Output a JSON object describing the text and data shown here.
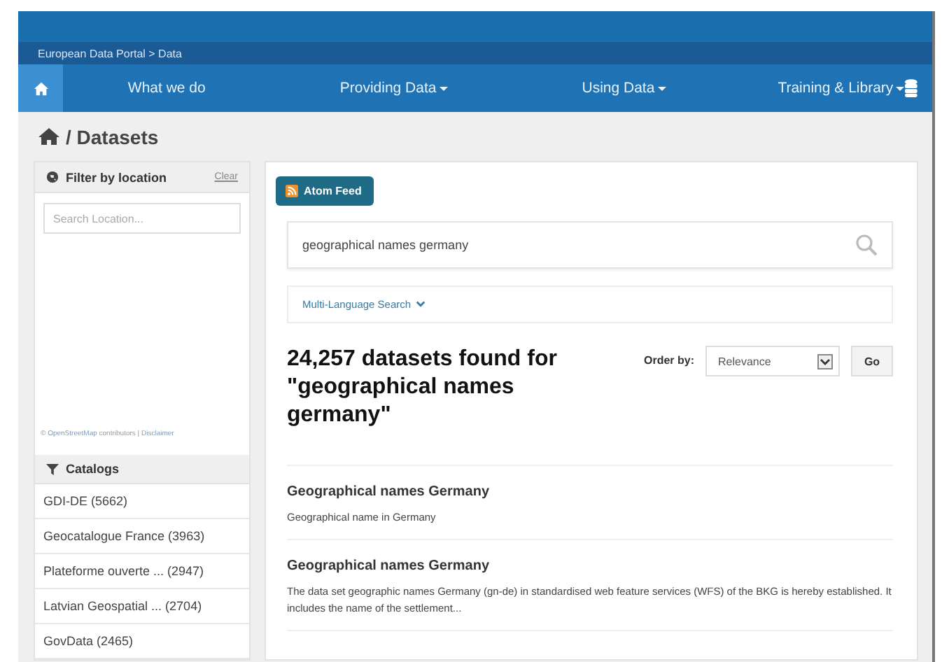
{
  "breadcrumb": "European Data Portal > Data",
  "nav": [
    {
      "label": "What we do",
      "dropdown": false
    },
    {
      "label": "Providing Data",
      "dropdown": true
    },
    {
      "label": "Using Data",
      "dropdown": true
    },
    {
      "label": "Training & Library",
      "dropdown": true
    }
  ],
  "page_title": "/ Datasets",
  "location_filter": {
    "title": "Filter by location",
    "clear": "Clear",
    "placeholder": "Search Location...",
    "attribution_prefix": "©",
    "attribution_link": "OpenStreetMap",
    "attribution_middle": "contributors |",
    "attribution_disclaimer": "Disclaimer"
  },
  "catalogs": {
    "title": "Catalogs",
    "items": [
      {
        "label": "GDI-DE (5662)"
      },
      {
        "label": "Geocatalogue France (3963)"
      },
      {
        "label": "Plateforme ouverte ... (2947)"
      },
      {
        "label": "Latvian Geospatial ... (2704)"
      },
      {
        "label": "GovData (2465)"
      }
    ]
  },
  "feed_button": "Atom Feed",
  "search": {
    "value": "geographical names germany"
  },
  "multi_language": "Multi-Language Search",
  "results_heading": "24,257 datasets found for \"geographical names germany\"",
  "order": {
    "label": "Order by:",
    "value": "Relevance",
    "go": "Go"
  },
  "results": [
    {
      "title": "Geographical names Germany",
      "description": "Geographical name in Germany"
    },
    {
      "title": "Geographical names Germany",
      "description": "The data set geographic names Germany (gn-de) in standardised web feature services (WFS) of the BKG is hereby established. It includes the name of the settlement..."
    }
  ]
}
